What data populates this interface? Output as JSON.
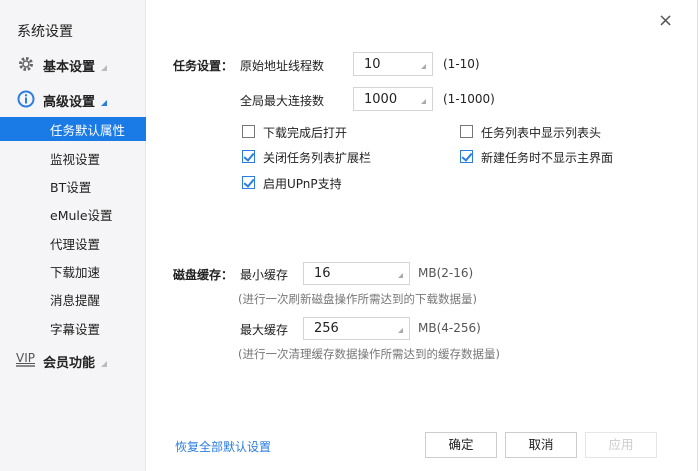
{
  "title": "系统设置",
  "close_icon": "×",
  "sidebar": {
    "groups": [
      {
        "label": "基本设置",
        "icon": "gear-icon"
      },
      {
        "label": "高级设置",
        "icon": "info-icon"
      },
      {
        "label": "会员功能",
        "icon": "vip-icon",
        "badge": "VIP"
      }
    ],
    "items": [
      {
        "label": "任务默认属性",
        "selected": true
      },
      {
        "label": "监视设置"
      },
      {
        "label": "BT设置"
      },
      {
        "label": "eMule设置"
      },
      {
        "label": "代理设置"
      },
      {
        "label": "下载加速"
      },
      {
        "label": "消息提醒"
      },
      {
        "label": "字幕设置"
      }
    ]
  },
  "task": {
    "section_label": "任务设置：",
    "threads_label": "原始地址线程数",
    "threads_value": "10",
    "threads_range": "(1-10)",
    "conn_label": "全局最大连接数",
    "conn_value": "1000",
    "conn_range": "(1-1000)",
    "checkboxes": [
      {
        "label": "下载完成后打开",
        "checked": false
      },
      {
        "label": "任务列表中显示列表头",
        "checked": false
      },
      {
        "label": "关闭任务列表扩展栏",
        "checked": true
      },
      {
        "label": "新建任务时不显示主界面",
        "checked": true
      },
      {
        "label": "启用UPnP支持",
        "checked": true
      }
    ]
  },
  "cache": {
    "section_label": "磁盘缓存：",
    "min_label": "最小缓存",
    "min_value": "16",
    "min_range": "MB(2-16)",
    "min_hint": "(进行一次刷新磁盘操作所需达到的下载数据量)",
    "max_label": "最大缓存",
    "max_value": "256",
    "max_range": "MB(4-256)",
    "max_hint": "(进行一次清理缓存数据操作所需达到的缓存数据量)"
  },
  "footer": {
    "restore": "恢复全部默认设置",
    "ok": "确定",
    "cancel": "取消",
    "apply": "应用"
  },
  "colors": {
    "accent": "#1a7be6",
    "link": "#2b7de0"
  }
}
